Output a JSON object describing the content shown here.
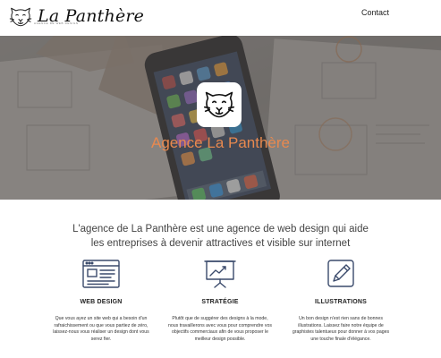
{
  "header": {
    "brand_name": "La Panthère",
    "brand_subtitle": "AGENCE DE WEB DESIGN",
    "brand_icon": "panther-head-icon",
    "nav": [
      {
        "label": "Contact"
      }
    ]
  },
  "hero": {
    "title": "Agence La Panthère",
    "logo_icon": "panther-head-icon",
    "title_color": "#e8894f"
  },
  "intro": {
    "line1": "L'agence de La Panthère est une agence de web design qui aide",
    "line2": "les entreprises à devenir attractives et visible sur internet"
  },
  "features": [
    {
      "icon": "browser-window-icon",
      "title": "WEB DESIGN",
      "text": "Que vous ayez un site web qui a besoin d'un rafraichissement ou que vous partiez de zéro, laissez-nous vous réaliser un design dont vous serez fier."
    },
    {
      "icon": "presentation-chart-icon",
      "title": "STRATÉGIE",
      "text": "Plutôt que de suggérer des designs à la mode, nous travaillerons avec vous pour comprendre vos objectifs commerciaux afin de vous proposer le meilleur design possible."
    },
    {
      "icon": "pencil-square-icon",
      "title": "ILLUSTRATIONS",
      "text": "Un bon design n'est rien sans de bonnes illustrations. Laissez faire notre équipe de graphistes talentueux pour donner à vos pages une touche finale d'élégance."
    }
  ],
  "colors": {
    "accent": "#e8894f",
    "icon_stroke": "#3a4a6b"
  }
}
